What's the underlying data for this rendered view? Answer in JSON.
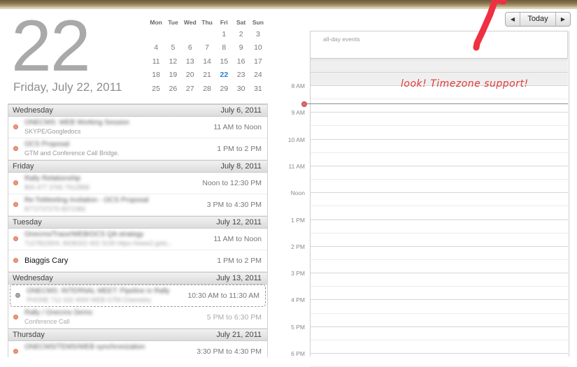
{
  "header": {
    "day_number": "22",
    "full_date": "Friday, July 22, 2011"
  },
  "mini_calendar": {
    "weekdays": [
      "Mon",
      "Tue",
      "Wed",
      "Thu",
      "Fri",
      "Sat",
      "Sun"
    ],
    "weeks": [
      [
        "",
        "",
        "",
        "",
        "1",
        "2",
        "3"
      ],
      [
        "4",
        "5",
        "6",
        "7",
        "8",
        "9",
        "10"
      ],
      [
        "11",
        "12",
        "13",
        "14",
        "15",
        "16",
        "17"
      ],
      [
        "18",
        "19",
        "20",
        "21",
        "22",
        "23",
        "24"
      ],
      [
        "25",
        "26",
        "27",
        "28",
        "29",
        "30",
        "31"
      ]
    ],
    "selected": "22"
  },
  "agenda": {
    "days": [
      {
        "weekday": "Wednesday",
        "date": "July 6, 2011",
        "events": [
          {
            "title": "ONECMS: WEB Working Session",
            "subtitle": "SKYPE/Googledocs",
            "time": "11 AM to Noon",
            "title_blurred": true,
            "subtitle_blurred": false
          },
          {
            "title": "OCS Proposal",
            "subtitle": "GTM and Conference Call Bridge.",
            "time": "1 PM to 2 PM",
            "title_blurred": true,
            "subtitle_blurred": false
          }
        ]
      },
      {
        "weekday": "Friday",
        "date": "July 8, 2011",
        "events": [
          {
            "title": "Rally Relationship",
            "subtitle": "800 477 3765 7912868",
            "time": "Noon to 12:30 PM",
            "title_blurred": true,
            "subtitle_blurred": true
          },
          {
            "title": "Re:ToMeeting Invitation - OCS Proposal",
            "subtitle": "8772737275 8372382",
            "time": "3 PM to 4:30 PM",
            "title_blurred": true,
            "subtitle_blurred": true
          }
        ]
      },
      {
        "weekday": "Tuesday",
        "date": "July 12, 2011",
        "events": [
          {
            "title": "Onecms/Trace/WEB/OCS QA strategy",
            "subtitle": "7127822604, 8436322 402 3130 https://www2.goto...",
            "time": "11 AM to Noon",
            "title_blurred": true,
            "subtitle_blurred": true
          },
          {
            "title": "Biaggis Cary",
            "subtitle": "",
            "time": "1 PM to 2 PM",
            "title_blurred": false,
            "subtitle_blurred": false
          }
        ]
      },
      {
        "weekday": "Wednesday",
        "date": "July 13, 2011",
        "events": [
          {
            "title": "ONECMS: INTERNAL MEET: Pipeline in Rally",
            "subtitle": "PHONE 712 432 4000 WEB GTM Chemistry",
            "time": "10:30 AM to 11:30 AM",
            "title_blurred": true,
            "subtitle_blurred": true,
            "selected": true
          },
          {
            "title": "Rally / Onecms Demo",
            "subtitle": "Conference Call",
            "time": "5 PM to 6:30 PM",
            "title_blurred": true,
            "subtitle_blurred": false,
            "faded": true
          }
        ]
      },
      {
        "weekday": "Thursday",
        "date": "July 21, 2011",
        "events": [
          {
            "title": "ONECMS/TEMS/WEB synchronization",
            "subtitle": "",
            "time": "3:30 PM to 4:30 PM",
            "title_blurred": true,
            "subtitle_blurred": false
          }
        ]
      }
    ]
  },
  "day_view": {
    "nav": {
      "prev": "◀",
      "today": "Today",
      "next": "▶"
    },
    "all_day_label": "all-day events",
    "hours": [
      "8 AM",
      "9 AM",
      "10 AM",
      "11 AM",
      "Noon",
      "1 PM",
      "2 PM",
      "3 PM",
      "4 PM",
      "5 PM",
      "6 PM"
    ],
    "annotation": "look!  Timezone support!"
  },
  "colors": {
    "event_dot": "#ec9a78",
    "today_accent": "#2b7bd6",
    "annotation": "#e23b3b"
  }
}
